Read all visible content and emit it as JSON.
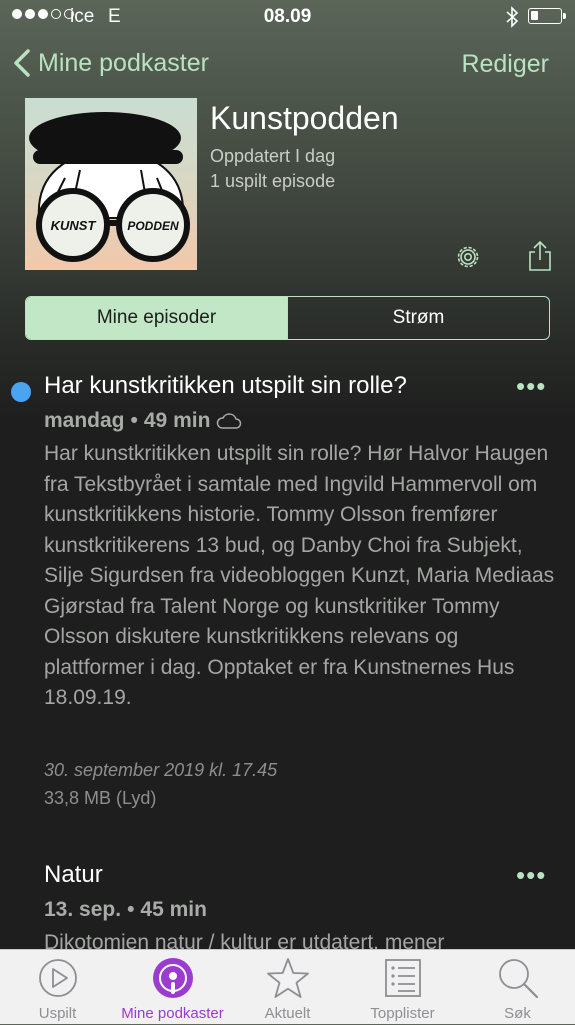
{
  "status_bar": {
    "carrier": "ice",
    "network": "E",
    "time": "08.09",
    "signal_dots_filled": 3,
    "signal_dots_total": 5,
    "battery_level": 0.25
  },
  "nav": {
    "back_label": "Mine podkaster",
    "edit_label": "Rediger"
  },
  "podcast": {
    "title": "Kunstpodden",
    "updated": "Oppdatert I dag",
    "unplayed": "1 uspilt episode",
    "artwork_left": "KUNST",
    "artwork_right": "PODDEN"
  },
  "segments": {
    "active": "Mine episoder",
    "inactive": "Strøm"
  },
  "episodes": [
    {
      "title": "Har kunstkritikken utspilt sin rolle?",
      "day": "mandag",
      "duration": "49 min",
      "description": "Har kunstkritikken utspilt sin rolle? Hør Halvor Haugen fra Tekstbyrået i samtale med Ingvild Hammervoll om kunstkritikkens historie. Tommy Olsson fremfører kunstkritikerens 13 bud, og Danby Choi fra Subjekt, Silje Sigurdsen fra videobloggen Kunzt, Maria Mediaas Gjørstad fra Talent Norge og kunstkritiker Tommy Olsson diskutere kunstkritikkens relevans og plattformer i dag. Opptaket er fra Kunstnernes Hus 18.09.19.",
      "published": "30. september 2019 kl. 17.45",
      "size": "33,8 MB (Lyd)"
    },
    {
      "title": "Natur",
      "day": "13. sep.",
      "duration": "45 min",
      "description": "Dikotomien natur / kultur er utdatert, mener"
    }
  ],
  "more_glyph": "•••",
  "tabs": [
    {
      "label": "Uspilt",
      "icon": "play-circle-icon"
    },
    {
      "label": "Mine podkaster",
      "icon": "podcast-icon"
    },
    {
      "label": "Aktuelt",
      "icon": "star-icon"
    },
    {
      "label": "Topplister",
      "icon": "list-icon"
    },
    {
      "label": "Søk",
      "icon": "search-icon"
    }
  ],
  "colors": {
    "accent": "#b9e3c0",
    "active_tab": "#9b3bd0",
    "unplayed_dot": "#49a4f2"
  }
}
